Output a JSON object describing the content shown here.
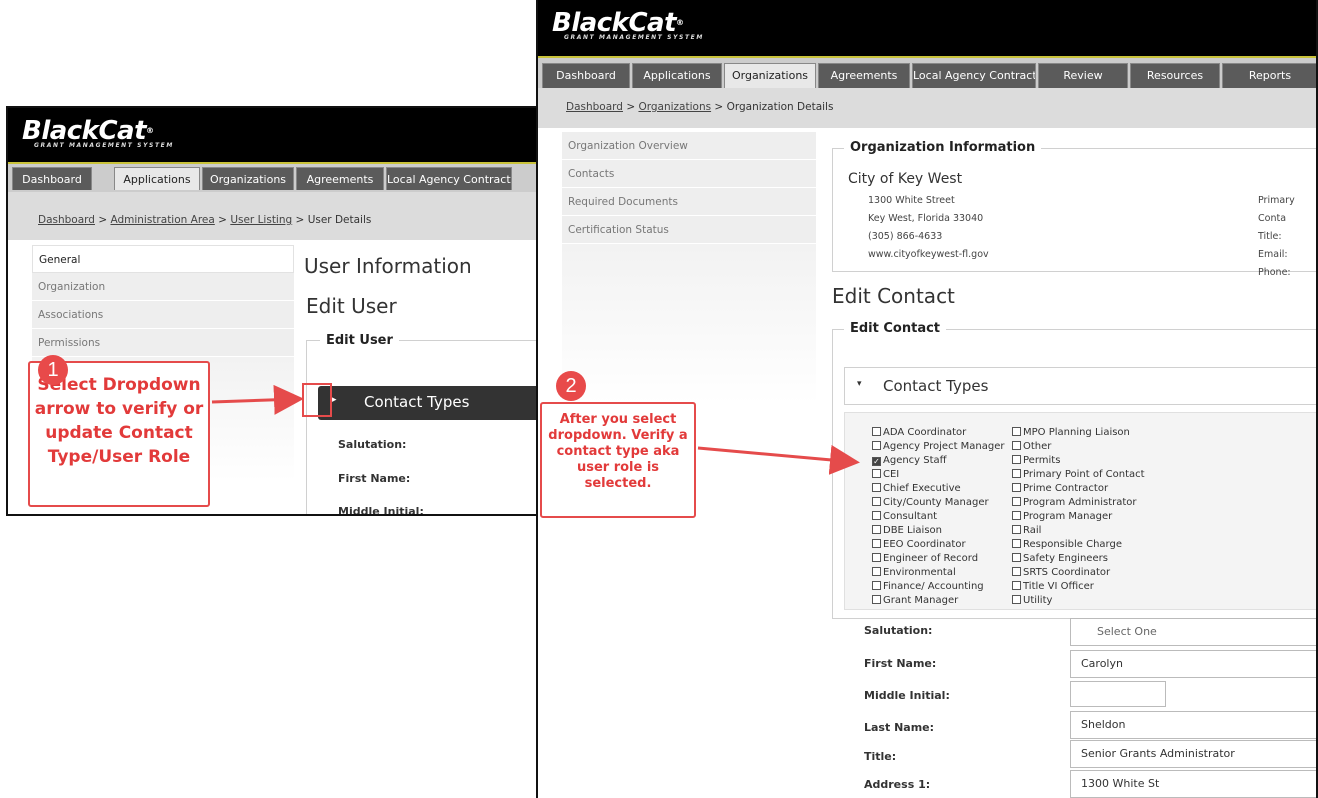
{
  "brand": {
    "name": "BlackCat",
    "tagline": "GRANT MANAGEMENT SYSTEM"
  },
  "panel1": {
    "tabs": [
      "Dashboard",
      "Applications",
      "Organizations",
      "Agreements",
      "Local Agency Contracts"
    ],
    "breadcrumb": {
      "dashboard": "Dashboard",
      "sep": ">",
      "admin": "Administration Area",
      "listing": "User Listing",
      "current": "User Details"
    },
    "side": [
      "General",
      "Organization",
      "Associations",
      "Permissions"
    ],
    "heading1": "User Information",
    "heading2": "Edit User",
    "fieldset_title": "Edit User",
    "contact_types": "Contact Types",
    "labels": {
      "salutation": "Salutation:",
      "first_name": "First Name:",
      "middle": "Middle Initial:"
    }
  },
  "panel2": {
    "tabs": [
      "Dashboard",
      "Applications",
      "Organizations",
      "Agreements",
      "Local Agency Contracts",
      "Review",
      "Resources",
      "Reports"
    ],
    "breadcrumb": {
      "dashboard": "Dashboard",
      "orgs": "Organizations",
      "current": "Organization Details"
    },
    "side": [
      "Organization Overview",
      "Contacts",
      "Required Documents",
      "Certification Status"
    ],
    "org_info": {
      "title": "Organization Information",
      "name": "City of Key West",
      "address1": "1300 White Street",
      "address2": "Key West, Florida 33040",
      "phone": "(305) 866-4633",
      "web": "www.cityofkeywest-fl.gov",
      "primary_contact": "Primary Conta",
      "title_lbl": "Title:",
      "email_lbl": "Email:",
      "phone_lbl": "Phone:"
    },
    "heading": "Edit Contact",
    "fieldset_title": "Edit Contact",
    "contact_types": "Contact Types",
    "types_left": [
      "ADA Coordinator",
      "Agency Project Manager",
      "Agency Staff",
      "CEI",
      "Chief Executive",
      "City/County Manager",
      "Consultant",
      "DBE Liaison",
      "EEO Coordinator",
      "Engineer of Record",
      "Environmental",
      "Finance/ Accounting",
      "Grant Manager"
    ],
    "types_right": [
      "MPO Planning Liaison",
      "Other",
      "Permits",
      "Primary Point of Contact",
      "Prime Contractor",
      "Program Administrator",
      "Program Manager",
      "Rail",
      "Responsible Charge",
      "Safety Engineers",
      "SRTS Coordinator",
      "Title VI Officer",
      "Utility"
    ],
    "checked": "Agency Staff",
    "fields": {
      "salutation_lbl": "Salutation:",
      "salutation_val": "Select One",
      "first_lbl": "First Name:",
      "first_val": "Carolyn",
      "middle_lbl": "Middle Initial:",
      "middle_val": "",
      "last_lbl": "Last Name:",
      "last_val": "Sheldon",
      "title_lbl": "Title:",
      "title_val": "Senior Grants Administrator",
      "addr_lbl": "Address 1:",
      "addr_val": "1300 White St"
    }
  },
  "callouts": {
    "c1": {
      "num": "1",
      "text": "Select Dropdown arrow to verify or update Contact Type/User Role"
    },
    "c2": {
      "num": "2",
      "text": "After you select dropdown. Verify a contact type aka user role is selected."
    }
  },
  "colors": {
    "accent": "#e54b4b",
    "header": "#000000",
    "tab": "#5b5b5b"
  }
}
